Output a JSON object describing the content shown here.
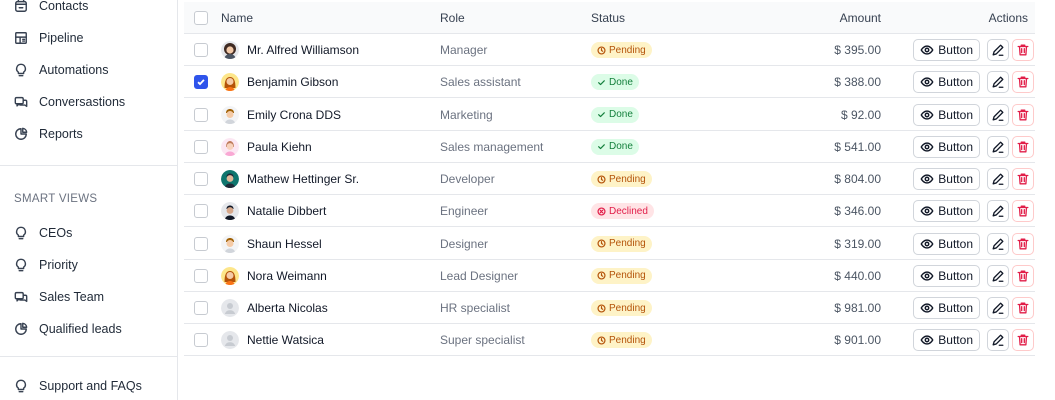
{
  "sidebar": {
    "main_items": [
      {
        "label": "Contacts",
        "icon": "contacts-icon"
      },
      {
        "label": "Pipeline",
        "icon": "pipeline-icon"
      },
      {
        "label": "Automations",
        "icon": "automations-icon"
      },
      {
        "label": "Conversastions",
        "icon": "conversations-icon"
      },
      {
        "label": "Reports",
        "icon": "reports-icon"
      }
    ],
    "smart_views_title": "SMART VIEWS",
    "smart_items": [
      {
        "label": "CEOs",
        "icon": "bulb-icon"
      },
      {
        "label": "Priority",
        "icon": "bulb-icon"
      },
      {
        "label": "Sales Team",
        "icon": "conversations-icon"
      },
      {
        "label": "Qualified leads",
        "icon": "reports-icon"
      }
    ],
    "support_label": "Support and FAQs"
  },
  "table": {
    "headers": {
      "name": "Name",
      "role": "Role",
      "status": "Status",
      "amount": "Amount",
      "actions": "Actions"
    },
    "view_button_label": "Button",
    "rows": [
      {
        "name": "Mr. Alfred Williamson",
        "role": "Manager",
        "status": "Pending",
        "amount": "$ 395.00",
        "checked": false,
        "avatar": "dark-hair"
      },
      {
        "name": "Benjamin Gibson",
        "role": "Sales assistant",
        "status": "Done",
        "amount": "$ 388.00",
        "checked": true,
        "avatar": "long-hair"
      },
      {
        "name": "Emily Crona DDS",
        "role": "Marketing",
        "status": "Done",
        "amount": "$ 92.00",
        "checked": false,
        "avatar": "short-hair"
      },
      {
        "name": "Paula Kiehn",
        "role": "Sales management",
        "status": "Done",
        "amount": "$ 541.00",
        "checked": false,
        "avatar": "pink"
      },
      {
        "name": "Mathew Hettinger Sr.",
        "role": "Developer",
        "status": "Pending",
        "amount": "$ 804.00",
        "checked": false,
        "avatar": "teal"
      },
      {
        "name": "Natalie Dibbert",
        "role": "Engineer",
        "status": "Declined",
        "amount": "$ 346.00",
        "checked": false,
        "avatar": "suit"
      },
      {
        "name": "Shaun Hessel",
        "role": "Designer",
        "status": "Pending",
        "amount": "$ 319.00",
        "checked": false,
        "avatar": "short-hair"
      },
      {
        "name": "Nora Weimann",
        "role": "Lead Designer",
        "status": "Pending",
        "amount": "$ 440.00",
        "checked": false,
        "avatar": "long-hair"
      },
      {
        "name": "Alberta Nicolas",
        "role": "HR specialist",
        "status": "Pending",
        "amount": "$ 981.00",
        "checked": false,
        "avatar": "placeholder"
      },
      {
        "name": "Nettie Watsica",
        "role": "Super specialist",
        "status": "Pending",
        "amount": "$ 901.00",
        "checked": false,
        "avatar": "placeholder"
      }
    ]
  },
  "status_styles": {
    "Pending": {
      "bg": "#fef3c7",
      "fg": "#b45309",
      "icon": "clock-icon"
    },
    "Done": {
      "bg": "#dcfce7",
      "fg": "#15803d",
      "icon": "check-icon"
    },
    "Declined": {
      "bg": "#ffe4e6",
      "fg": "#e11d48",
      "icon": "x-circle-icon"
    }
  },
  "colors": {
    "accent": "#2f54eb",
    "danger": "#e11d48"
  }
}
